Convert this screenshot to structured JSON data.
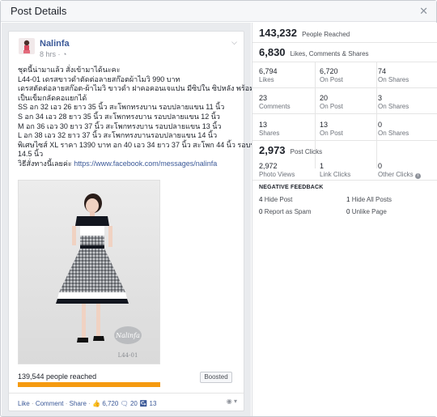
{
  "dialog": {
    "title": "Post Details",
    "close_icon": "close-icon"
  },
  "post": {
    "author": "Nalinfa",
    "time": "8 hrs",
    "audience_icon": "globe-icon",
    "text_lines": [
      "ชุดนี้น่ามาแล้ว สั่งเข้ามาได้นะคะ",
      "L44-01 เดรสขาวดำตัดต่อลายสก๊อตผ้าไมวิ 990 บาท",
      "เดรสตัดต่อลายสก๊อต-ผ้าไมวิ ขาวดำ ฝาคอคอนเจแปน มีซิปใน ซิปหลัง พร้อมโบ ไมคิต",
      "เป็นเข็มกลัดคอแยกได้",
      "SS อก 32 เอว 26 ยาว 35 นิ้ว สะโพกทรงบาน รอบปลายแขน 11 นิ้ว",
      "S อก 34 เอว 28 ยาว 35 นิ้ว สะโพกทรงบาน รอบปลายแขน 12 นิ้ว",
      "M อก 36 เอว 30 ยาว 37 นิ้ว สะโพกทรงบาน รอบปลายแขน 13 นิ้ว",
      "L อก 38 เอว 32 ยาว 37 นิ้ว สะโพกทรงบานรอบปลายแขน 14 นิ้ว",
      "พิเศษไซส์ XL ราคา 1390 บาท อก 40 เอว 34 ยาว 37 นิ้ว สะโพก 44 นิ้ว รอบปลายแขน",
      "14.5 นิ้ว"
    ],
    "order_prefix": "วิธีสั่งทางนี้เลยค่ะ",
    "order_link": "https://www.facebook.com/messages/nalinfa",
    "photo_watermark": "Nalinfa",
    "photo_code": "L44-01",
    "reach_text": "139,544 people reached",
    "reach_progress_percent": 100,
    "boosted_label": "Boosted",
    "actions": {
      "like": "Like",
      "comment": "Comment",
      "share": "Share",
      "likes_count": "6,720",
      "comments_count": "20",
      "shares_count": "13"
    }
  },
  "stats": {
    "people_reached": {
      "value": "143,232",
      "label": "People Reached"
    },
    "engagement": {
      "value": "6,830",
      "label": "Likes, Comments & Shares"
    },
    "likes_row": [
      {
        "value": "6,794",
        "label": "Likes"
      },
      {
        "value": "6,720",
        "label": "On Post"
      },
      {
        "value": "74",
        "label": "On Shares"
      }
    ],
    "comments_row": [
      {
        "value": "23",
        "label": "Comments"
      },
      {
        "value": "20",
        "label": "On Post"
      },
      {
        "value": "3",
        "label": "On Shares"
      }
    ],
    "shares_row": [
      {
        "value": "13",
        "label": "Shares"
      },
      {
        "value": "13",
        "label": "On Post"
      },
      {
        "value": "0",
        "label": "On Shares"
      }
    ],
    "post_clicks": {
      "value": "2,973",
      "label": "Post Clicks"
    },
    "clicks_row": [
      {
        "value": "2,972",
        "label": "Photo Views"
      },
      {
        "value": "1",
        "label": "Link Clicks"
      },
      {
        "value": "0",
        "label": "Other Clicks"
      }
    ],
    "negative_feedback": {
      "title": "NEGATIVE FEEDBACK",
      "items": [
        {
          "value": "4",
          "label": "Hide Post"
        },
        {
          "value": "1",
          "label": "Hide All Posts"
        },
        {
          "value": "0",
          "label": "Report as Spam"
        },
        {
          "value": "0",
          "label": "Unlike Page"
        }
      ]
    }
  },
  "colors": {
    "link": "#3b5998",
    "reach_bar": "#f59a10"
  }
}
